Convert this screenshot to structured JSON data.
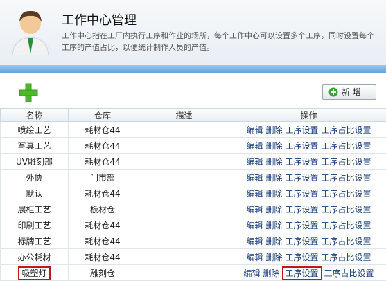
{
  "header": {
    "title": "工作中心管理",
    "description": "工作中心指在工厂内执行工序和作业的场所，每个工作中心可以设置多个工序，同时设置每个工序的产值占比，以便统计制作人员的产值。"
  },
  "toolbar": {
    "add_label": "新增"
  },
  "table": {
    "columns": [
      "名称",
      "仓库",
      "描述",
      "操作"
    ],
    "ops": [
      "编辑",
      "删除",
      "工序设置",
      "工序占比设置"
    ],
    "rows": [
      {
        "name": "喷绘工艺",
        "warehouse": "耗材仓44",
        "desc": ""
      },
      {
        "name": "写真工艺",
        "warehouse": "耗材仓44",
        "desc": ""
      },
      {
        "name": "UV雕刻部",
        "warehouse": "耗材仓44",
        "desc": ""
      },
      {
        "name": "外协",
        "warehouse": "门市部",
        "desc": ""
      },
      {
        "name": "默认",
        "warehouse": "耗材仓44",
        "desc": ""
      },
      {
        "name": "展柜工艺",
        "warehouse": "板材仓",
        "desc": ""
      },
      {
        "name": "印刷工艺",
        "warehouse": "耗材仓44",
        "desc": ""
      },
      {
        "name": "标牌工艺",
        "warehouse": "耗材仓44",
        "desc": ""
      },
      {
        "name": "办公耗材",
        "warehouse": "耗材仓44",
        "desc": ""
      },
      {
        "name": "吸塑灯",
        "warehouse": "雕刻仓",
        "desc": ""
      }
    ]
  },
  "highlight_color": "#c01818"
}
